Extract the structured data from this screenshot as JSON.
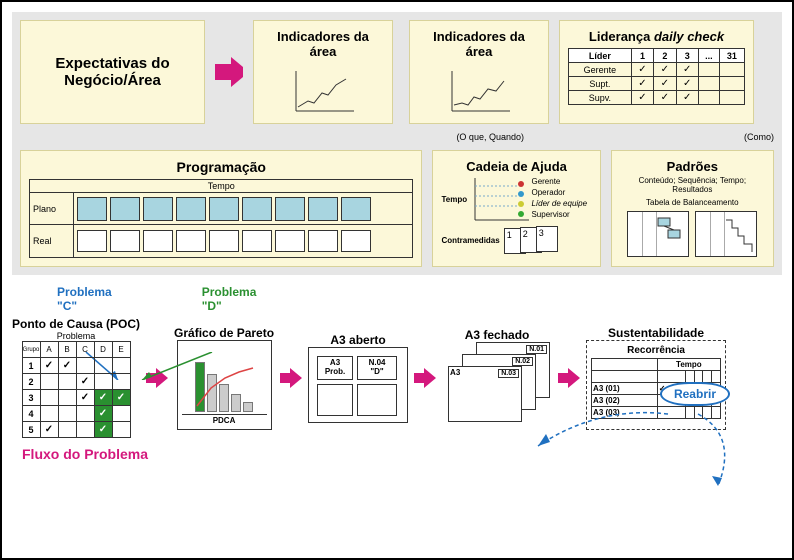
{
  "top": {
    "expectativas": "Expectativas do Negócio/Área",
    "indicadores": "Indicadores da área",
    "o_que_quando": "(O que, Quando)",
    "como": "(Como)",
    "leadership": {
      "title": "Liderança daily check",
      "col_lider": "Líder",
      "cols": [
        "1",
        "2",
        "3",
        "...",
        "31"
      ],
      "rows": [
        "Gerente",
        "Supt.",
        "Supv."
      ]
    }
  },
  "row2": {
    "programacao": {
      "title": "Programação",
      "tempo": "Tempo",
      "plano": "Plano",
      "real": "Real"
    },
    "cadeia": {
      "title": "Cadeia de Ajuda",
      "tempo": "Tempo",
      "roles": [
        "Gerente",
        "Operador",
        "Líder de equipe",
        "Supervisor"
      ],
      "contramedidas": "Contramedidas"
    },
    "padroes": {
      "title": "Padrões",
      "sub": "Conteúdo; Sequência; Tempo; Resultados",
      "sub2": "Tabela de Balanceamento"
    }
  },
  "flow_labels": {
    "problema_c": "Problema \"C\"",
    "problema_d": "Problema \"D\""
  },
  "stages": {
    "poc": {
      "title": "Ponto de Causa (POC)",
      "sub": "Problema",
      "grupo": "Grupo",
      "cols": [
        "A",
        "B",
        "C",
        "D",
        "E"
      ],
      "rows": [
        "1",
        "2",
        "3",
        "4",
        "5"
      ],
      "grid": [
        [
          true,
          true,
          false,
          false,
          false
        ],
        [
          false,
          false,
          true,
          false,
          false
        ],
        [
          false,
          false,
          true,
          "g",
          "g"
        ],
        [
          false,
          false,
          false,
          "g",
          false
        ],
        [
          true,
          false,
          false,
          "g",
          false
        ]
      ]
    },
    "pareto": {
      "title": "Gráfico de Pareto",
      "pdca": "PDCA"
    },
    "a3_open": {
      "title": "A3 aberto",
      "cell1": "A3\nProb.",
      "cell2": "N.04\n\"D\""
    },
    "a3_closed": {
      "title": "A3 fechado",
      "tags": [
        "N.01",
        "N.02",
        "N.03"
      ],
      "a3": "A3"
    },
    "sust": {
      "title": "Sustentabilidade",
      "recorrencia": "Recorrência",
      "tempo": "Tempo",
      "rows": [
        "A3 (01)",
        "A3 (02)",
        "A3 (03)"
      ]
    }
  },
  "reabrir": "Reabrir",
  "fluxo": "Fluxo do Problema",
  "chart_data": {
    "type": "diagram",
    "note": "Process-flow / management-board diagram. No quantitative axes; content is structural and captured in the JSON above."
  }
}
